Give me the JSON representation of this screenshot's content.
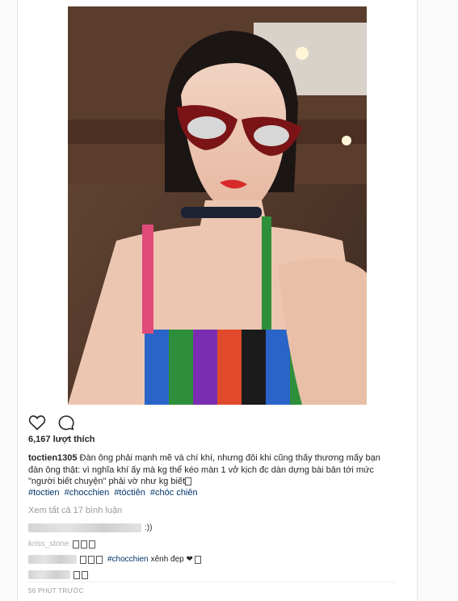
{
  "post": {
    "likes_text": "6,167 lượt thích",
    "caption": {
      "username": "toctien1305",
      "text": "Đàn ông phải mạnh mẽ và chí khí, nhưng đôi khi cũng thấy thương mấy bạn đàn ông thật: vì nghĩa khí ấy mà kg thể kéo màn 1 vở kịch đc dàn dựng bài bản tới mức \"người biết chuyện\" phải vờ như kg biết"
    },
    "hashtags": [
      "#toctien",
      "#chocchien",
      "#tóctiên",
      "#chóc chiên"
    ],
    "view_all_comments": "Xem tất cả 17 bình luận",
    "comments": [
      {
        "text": ":))"
      },
      {
        "text": "kriss_stone"
      },
      {
        "hashtag": "#chocchien",
        "text": "xênh đẹp ❤"
      },
      {
        "text": ""
      }
    ],
    "timestamp": "56 PHÚT TRƯỚC"
  },
  "icons": {
    "like": "heart-icon",
    "comment": "comment-bubble-icon"
  }
}
